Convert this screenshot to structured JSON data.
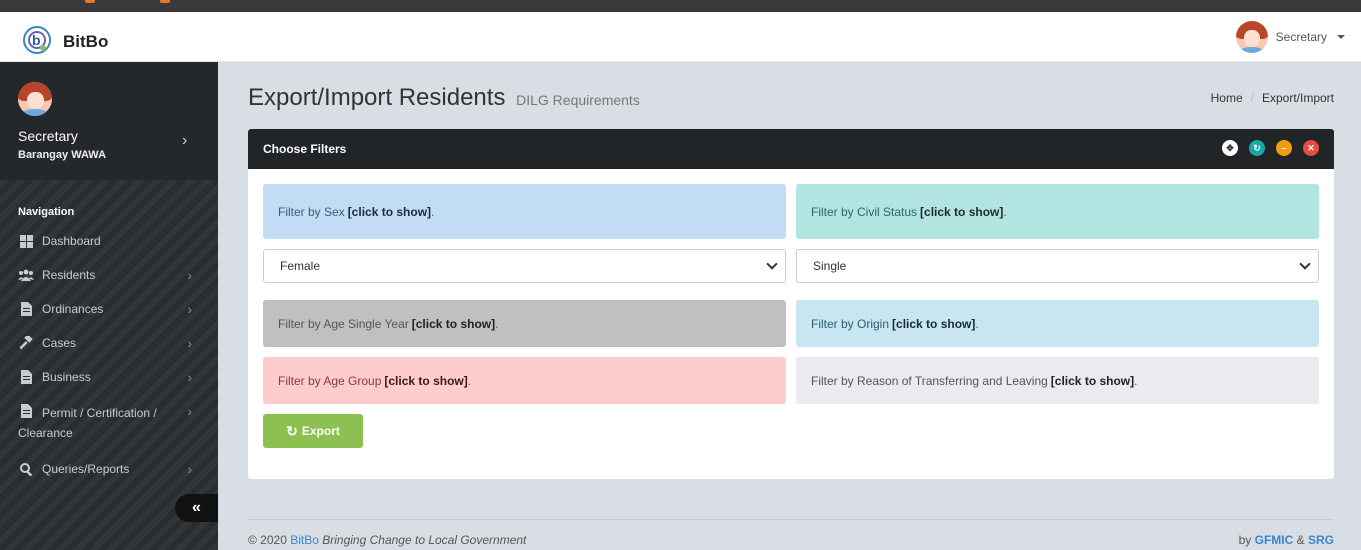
{
  "app": {
    "brand": "BitBo"
  },
  "topbar": {
    "user_name": "Secretary"
  },
  "sidebar": {
    "role": "Secretary",
    "barangay": "Barangay WAWA",
    "nav_heading": "Navigation",
    "items": [
      {
        "label": "Dashboard",
        "icon": "dashboard-icon",
        "has_chevron": false
      },
      {
        "label": "Residents",
        "icon": "users-icon",
        "has_chevron": true
      },
      {
        "label": "Ordinances",
        "icon": "document-icon",
        "has_chevron": true
      },
      {
        "label": "Cases",
        "icon": "gavel-icon",
        "has_chevron": true
      },
      {
        "label": "Business",
        "icon": "document-icon",
        "has_chevron": true
      },
      {
        "label": "Permit / Certification / Clearance",
        "icon": "document-icon",
        "has_chevron": true
      },
      {
        "label": "Queries/Reports",
        "icon": "search-icon",
        "has_chevron": true
      }
    ],
    "collapse_icon": "double-chevron-left-icon"
  },
  "page": {
    "title": "Export/Import Residents",
    "subtitle": "DILG Requirements",
    "breadcrumb": [
      "Home",
      "Export/Import"
    ]
  },
  "panel": {
    "title": "Choose Filters",
    "tools": [
      "expand-icon",
      "refresh-icon",
      "minimize-icon",
      "close-icon"
    ],
    "tool_colors": [
      "#ffffff",
      "#19a9a5",
      "#f39c12",
      "#e74c3c"
    ]
  },
  "filters": {
    "click_text": "[click to show]",
    "sex": {
      "label": "Filter by Sex",
      "color": "#c2dcf5"
    },
    "civil_status": {
      "label": "Filter by Civil Status",
      "color": "#b2e4e2"
    },
    "age_single_year": {
      "label": "Filter by Age Single Year",
      "color": "#c0c0c0"
    },
    "origin": {
      "label": "Filter by Origin",
      "color": "#c7e6f2"
    },
    "age_group": {
      "label": "Filter by Age Group",
      "color": "#fdcccc"
    },
    "reason": {
      "label": "Filter by Reason of Transferring and Leaving",
      "color": "#e9ebee"
    }
  },
  "selects": {
    "sex_value": "Female",
    "civil_status_value": "Single"
  },
  "export_button": {
    "label": "Export",
    "color": "#8cc152"
  },
  "footer": {
    "copyright": "© 2020",
    "brand": "BitBo",
    "tagline": "Bringing Change to Local Government",
    "by": "by",
    "org1": "GFMIC",
    "amp": "&",
    "org2": "SRG"
  }
}
